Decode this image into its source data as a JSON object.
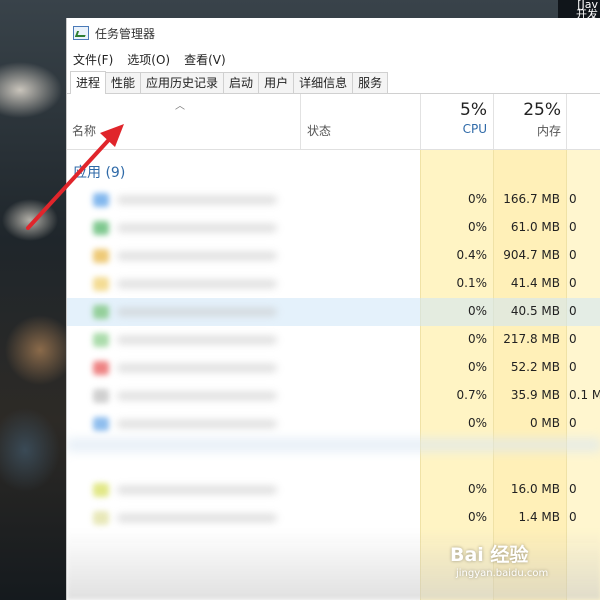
{
  "desktop": {
    "corner_lines": [
      "[Jav",
      "开发"
    ]
  },
  "window": {
    "title": "任务管理器",
    "menu": [
      "文件(F)",
      "选项(O)",
      "查看(V)"
    ],
    "tabs": [
      "进程",
      "性能",
      "应用历史记录",
      "启动",
      "用户",
      "详细信息",
      "服务"
    ],
    "active_tab": "进程"
  },
  "header": {
    "name_label": "名称",
    "status_label": "状态",
    "cpu_percent": "5%",
    "cpu_label": "CPU",
    "memory_percent": "25%",
    "memory_label": "内存"
  },
  "group": {
    "label": "应用 (9)"
  },
  "rows": [
    {
      "cpu": "0%",
      "memory": "166.7 MB",
      "more": "0",
      "icon_color": "#5aa0e8"
    },
    {
      "cpu": "0%",
      "memory": "61.0 MB",
      "more": "0",
      "icon_color": "#55b66a"
    },
    {
      "cpu": "0.4%",
      "memory": "904.7 MB",
      "more": "0",
      "icon_color": "#e8b84a"
    },
    {
      "cpu": "0.1%",
      "memory": "41.4 MB",
      "more": "0",
      "icon_color": "#f0d070"
    },
    {
      "cpu": "0%",
      "memory": "40.5 MB",
      "more": "0",
      "icon_color": "#7ac47a",
      "selected": true
    },
    {
      "cpu": "0%",
      "memory": "217.8 MB",
      "more": "0",
      "icon_color": "#8fd08f"
    },
    {
      "cpu": "0%",
      "memory": "52.2 MB",
      "more": "0",
      "icon_color": "#e85a5a"
    },
    {
      "cpu": "0.7%",
      "memory": "35.9 MB",
      "more": "0.1 M",
      "icon_color": "#c0c0c0"
    },
    {
      "cpu": "0%",
      "memory": "0 MB",
      "more": "0",
      "icon_color": "#6aa8e8"
    },
    {
      "cpu": "",
      "memory": "",
      "more": "",
      "icon_color": "#ffffff",
      "spacer": true
    },
    {
      "cpu": "0%",
      "memory": "16.0 MB",
      "more": "0",
      "icon_color": "#d8e060"
    },
    {
      "cpu": "0%",
      "memory": "1.4 MB",
      "more": "0",
      "icon_color": "#e0e0a0"
    }
  ],
  "watermark": {
    "logo": "Bai 经验",
    "url": "jingyan.baidu.com"
  }
}
